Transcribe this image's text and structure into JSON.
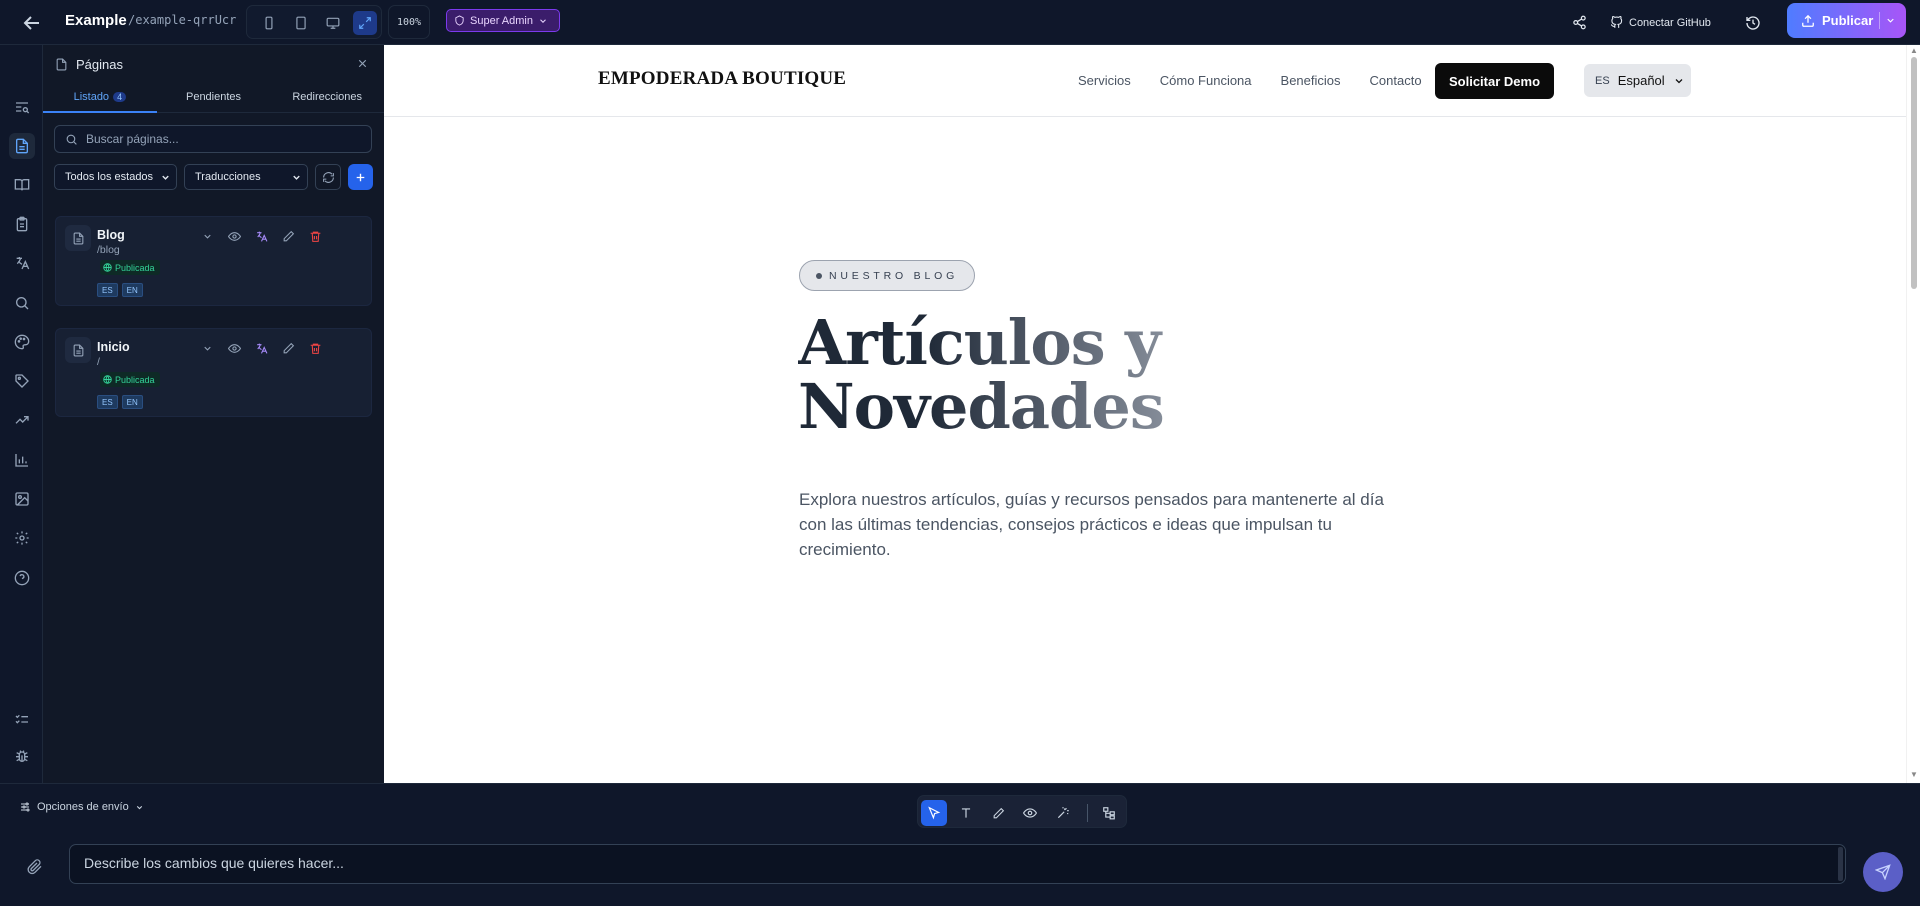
{
  "topbar": {
    "title": "Example",
    "slug": "/example-qrrUcr",
    "zoom": "100%",
    "role": "Super Admin",
    "connect_github": "Conectar GitHub",
    "publish": "Publicar"
  },
  "panel": {
    "title": "Páginas",
    "tabs": [
      {
        "label": "Listado",
        "count": "4"
      },
      {
        "label": "Pendientes"
      },
      {
        "label": "Redirecciones"
      }
    ],
    "search_placeholder": "Buscar páginas...",
    "status_filter": "Todos los estados",
    "translation_filter": "Traducciones",
    "pages": [
      {
        "name": "Blog",
        "path": "/blog",
        "status": "Publicada",
        "langs": [
          "ES",
          "EN"
        ]
      },
      {
        "name": "Inicio",
        "path": "/",
        "status": "Publicada",
        "langs": [
          "ES",
          "EN"
        ]
      }
    ]
  },
  "site": {
    "logo": "EMPODERADA BOUTIQUE",
    "nav": [
      "Servicios",
      "Cómo Funciona",
      "Beneficios",
      "Contacto"
    ],
    "cta": "Solicitar Demo",
    "lang_code": "ES",
    "lang_label": "Español",
    "pill": "NUESTRO BLOG",
    "hero_line1": "Artículos y",
    "hero_line2": "Novedades",
    "lead": "Explora nuestros artículos, guías y recursos pensados para mantenerte al día con las últimas tendencias, consejos prácticos e ideas que impulsan tu crecimiento."
  },
  "bottom": {
    "send_options": "Opciones de envío",
    "prompt_placeholder": "Describe los cambios que quieres hacer..."
  },
  "colors": {
    "accent": "#2563eb",
    "publish_gradient_start": "#4f7cff",
    "publish_gradient_end": "#a855f7",
    "status_green": "#34d399",
    "role_purple": "#7c3aed"
  }
}
